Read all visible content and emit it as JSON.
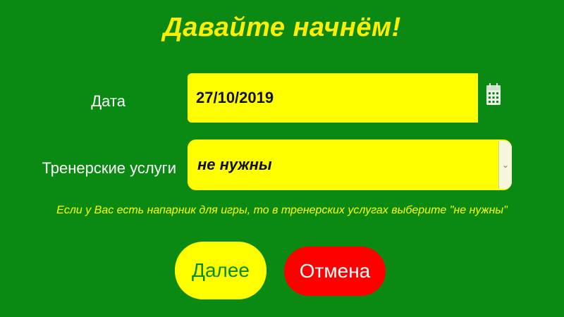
{
  "title": "Давайте начнём!",
  "form": {
    "date_label": "Дата",
    "date_value": "27/10/2019",
    "service_label": "Тренерские услуги",
    "service_selected": "не нужны",
    "hint": "Если у Вас есть напарник для игры, то в тренерских услугах выберите \"не нужны\""
  },
  "buttons": {
    "next_label": "Далее",
    "cancel_label": "Отмена"
  },
  "icons": {
    "date_picker": "calendar-icon",
    "select_arrow": "chevron-down-icon"
  },
  "colors": {
    "background": "#0a8a12",
    "accent_yellow": "#ffff00",
    "cancel_red": "#ff0000"
  }
}
